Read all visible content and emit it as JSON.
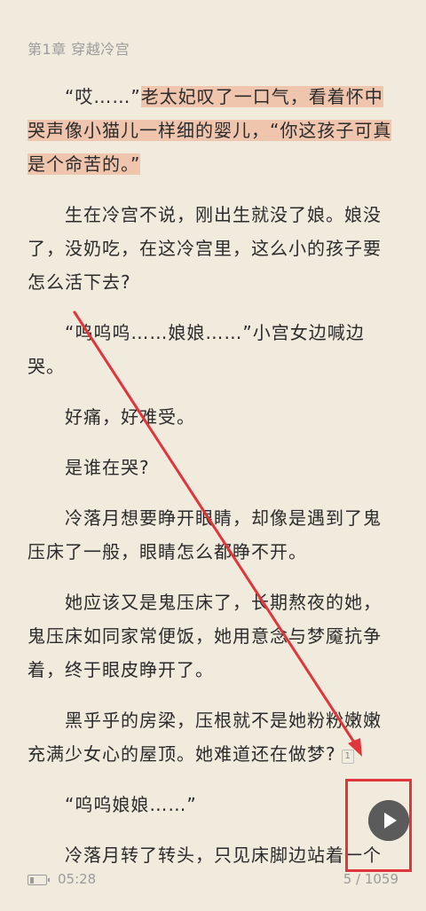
{
  "chapter": {
    "title": "第1章 穿越冷宫"
  },
  "paragraphs": [
    {
      "highlight_open": "“哎……”",
      "highlight_text": "老太妃叹了一口气，看着怀中哭声像小猫儿一样细的婴儿，“你这孩子可真是个命苦的。”"
    },
    {
      "text": "生在冷宫不说，刚出生就没了娘。娘没了，没奶吃，在这冷宫里，这么小的孩子要怎么活下去?"
    },
    {
      "text": "“呜呜呜……娘娘……”小宫女边喊边哭。"
    },
    {
      "text": "好痛，好难受。"
    },
    {
      "text": "是谁在哭?"
    },
    {
      "text": "冷落月想要睁开眼睛，却像是遇到了鬼压床了一般，眼睛怎么都睁不开。"
    },
    {
      "text": "她应该又是鬼压床了，长期熬夜的她，鬼压床如同家常便饭，她用意念与梦魇抗争着，终于眼皮睁开了。"
    },
    {
      "text": "黑乎乎的房梁，压根就不是她粉粉嫩嫩充满少女心的屋顶。她难道还在做梦?",
      "note": "1"
    },
    {
      "text": "“呜呜娘娘……”"
    },
    {
      "text": "冷落月转了转头，只见床脚边站着一个"
    }
  ],
  "footer": {
    "time": "05:28",
    "page_indicator": "5 / 1059",
    "battery_level": 0.3
  },
  "colors": {
    "background": "#f1ebde",
    "highlight": "#f0c5ad",
    "annotation_red": "#e0353a",
    "play_button": "#5b5b5b"
  },
  "icons": {
    "play": "play-icon",
    "battery": "battery-icon"
  }
}
